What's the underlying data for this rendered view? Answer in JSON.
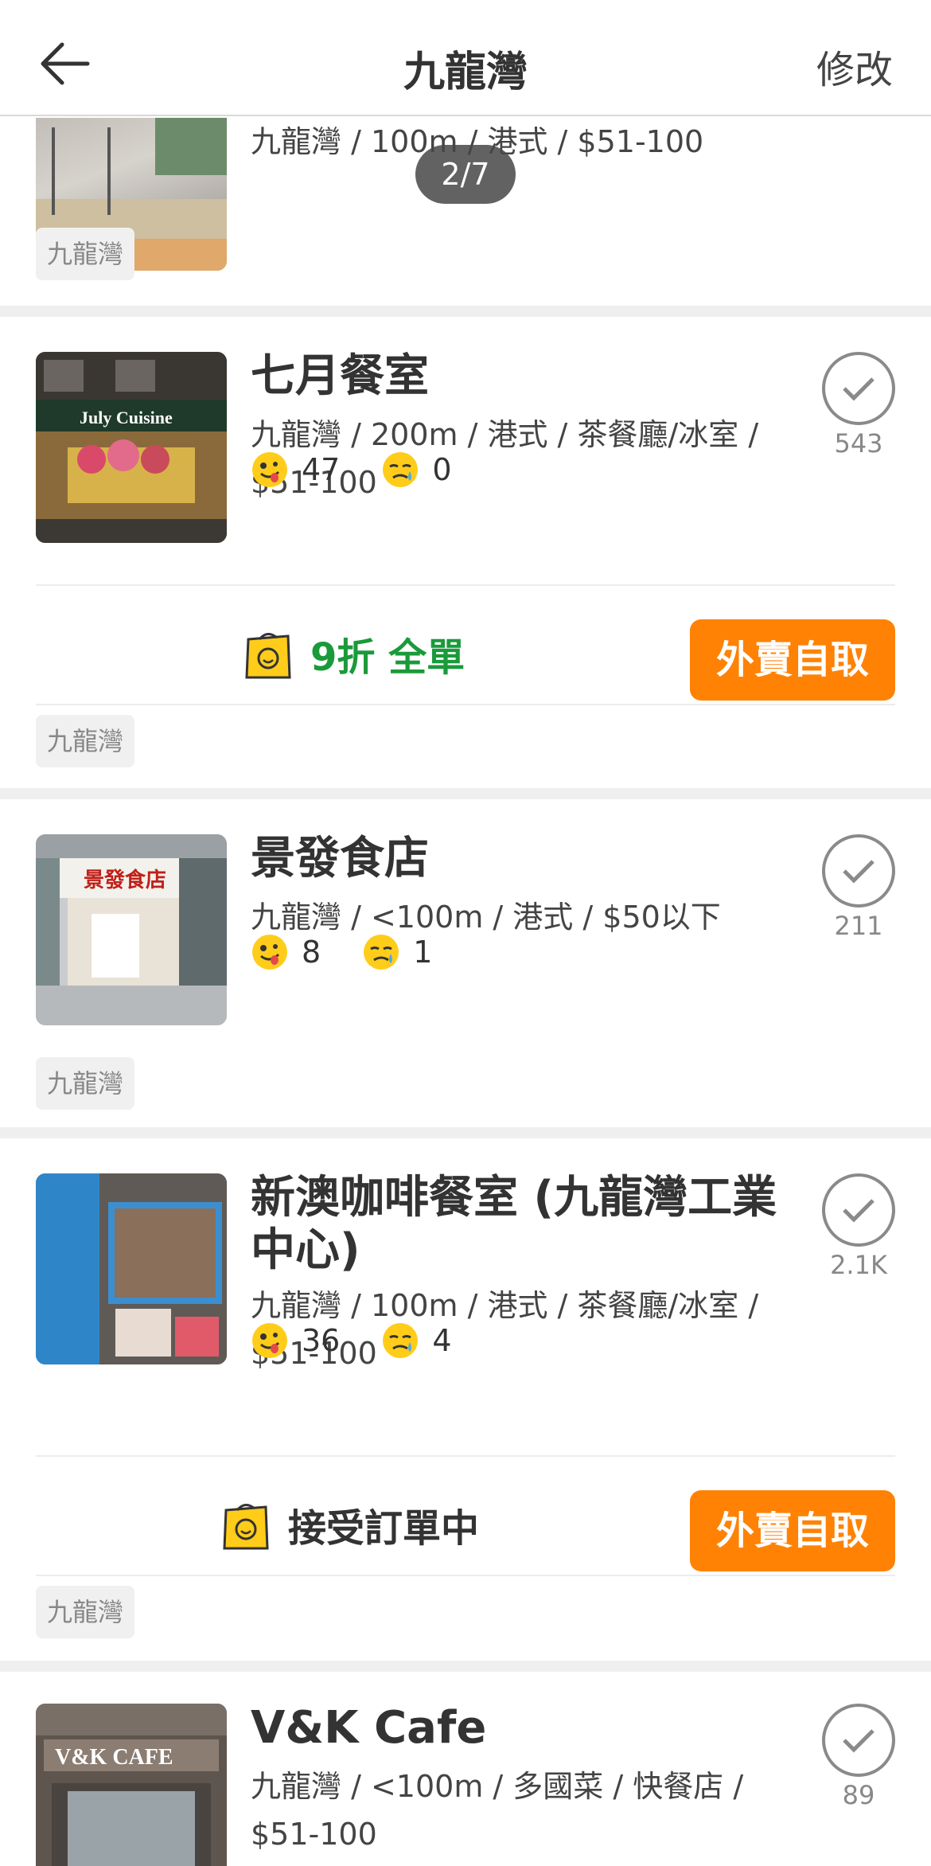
{
  "header": {
    "title": "九龍灣",
    "edit_label": "修改"
  },
  "pager": {
    "label": "2/7"
  },
  "restaurants": [
    {
      "meta": "九龍灣 / 100m / 港式 / $51-100",
      "tag": "九龍灣"
    },
    {
      "name": "七月餐室",
      "meta": "九龍灣 / 200m / 港式 / 茶餐廳/冰室 / $51-100",
      "smile": "47",
      "cry": "0",
      "bookmarks": "543",
      "promo": "9折 全單",
      "takeaway": "外賣自取",
      "tag": "九龍灣",
      "thumb_sign": "July Cuisine"
    },
    {
      "name": "景發食店",
      "meta": "九龍灣 / <100m / 港式 / $50以下",
      "smile": "8",
      "cry": "1",
      "bookmarks": "211",
      "tag": "九龍灣",
      "thumb_sign": "景發食店"
    },
    {
      "name": "新澳咖啡餐室 (九龍灣工業中心)",
      "meta": "九龍灣 / 100m / 港式 / 茶餐廳/冰室 / $51-100",
      "smile": "36",
      "cry": "4",
      "bookmarks": "2.1K",
      "promo": "接受訂單中",
      "takeaway": "外賣自取",
      "tag": "九龍灣"
    },
    {
      "name": "V&K Cafe",
      "meta": "九龍灣 / <100m / 多國菜 / 快餐店 / $51-100",
      "bookmarks": "89",
      "thumb_sign": "V&K CAFE"
    }
  ],
  "icons": {
    "back": "arrow-left-icon",
    "bookmark": "check-circle-icon",
    "smile": "smile-face-icon",
    "cry": "cry-face-icon",
    "bag": "takeaway-bag-icon"
  },
  "colors": {
    "accent": "#ff8205",
    "promo_green": "#1a9a3a"
  }
}
